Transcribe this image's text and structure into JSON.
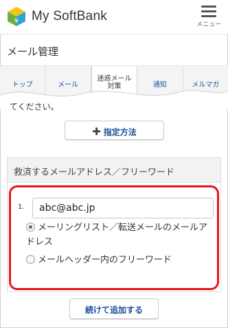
{
  "header": {
    "app_title": "My SoftBank",
    "menu_label": "メニュー",
    "logo_icon": "softbank-cube-logo",
    "colors": {
      "logo_yellow": "#f0c419",
      "logo_green": "#6cb043",
      "logo_blue": "#2ea3d8"
    }
  },
  "page": {
    "section_title": "メール管理"
  },
  "tabs": [
    {
      "label": "トップ",
      "active": false
    },
    {
      "label": "メール",
      "active": false
    },
    {
      "label": "迷惑メール\n対策",
      "active": true
    },
    {
      "label": "通知",
      "active": false
    },
    {
      "label": "メルマガ",
      "active": false
    }
  ],
  "content": {
    "cut_text": "てください。",
    "spec_button_label": "指定方法",
    "panel_title": "救済するメールアドレス／フリーワード",
    "entry_number": "1.",
    "email_value": "abc@abc.jp",
    "radio_options": [
      {
        "label": "メーリングリスト／転送メールのメールアドレス",
        "checked": true
      },
      {
        "label": "メールヘッダー内のフリーワード",
        "checked": false
      }
    ],
    "continue_button_label": "続けて追加する",
    "highlight_color": "#e8141b"
  }
}
